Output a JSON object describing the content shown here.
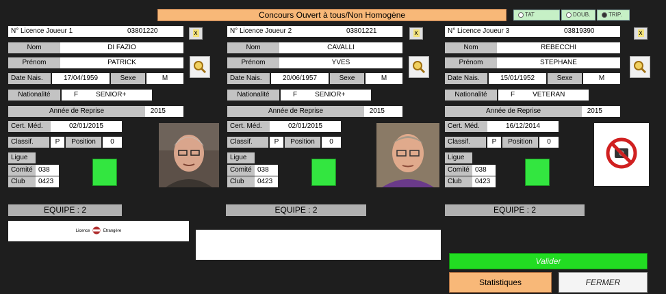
{
  "window": {
    "title": "Concours Ouvert à tous/Non Homogène"
  },
  "mode_options": [
    {
      "label": "TAT",
      "selected": false
    },
    {
      "label": "DOUB.",
      "selected": false
    },
    {
      "label": "TRIP.",
      "selected": true
    }
  ],
  "labels": {
    "nom": "Nom",
    "prenom": "Prénom",
    "date_nais": "Date Nais.",
    "sexe": "Sexe",
    "nationalite": "Nationalité",
    "annee_reprise": "Année de Reprise",
    "cert_med": "Cert. Méd.",
    "classif": "Classif.",
    "position": "Position",
    "ligue": "Ligue",
    "comite": "Comité",
    "club": "Club",
    "remove_btn": "x"
  },
  "players": [
    {
      "licence_label": "N° Licence Joueur 1",
      "licence": "03801220",
      "nom": "DI FAZIO",
      "prenom": "PATRICK",
      "date_nais": "17/04/1959",
      "sexe": "M",
      "nationalite": "F",
      "categorie": "SENIOR+",
      "annee_reprise": "2015",
      "cert_med": "02/01/2015",
      "classif": "P",
      "position": "0",
      "comite": "038",
      "club": "0423",
      "equipe": "EQUIPE : 2",
      "photo": "player-photo"
    },
    {
      "licence_label": "N° Licence Joueur 2",
      "licence": "03801221",
      "nom": "CAVALLI",
      "prenom": "YVES",
      "date_nais": "20/06/1957",
      "sexe": "M",
      "nationalite": "F",
      "categorie": "SENIOR+",
      "annee_reprise": "2015",
      "cert_med": "02/01/2015",
      "classif": "P",
      "position": "0",
      "comite": "038",
      "club": "0423",
      "equipe": "EQUIPE : 2",
      "photo": "player-photo"
    },
    {
      "licence_label": "N° Licence Joueur 3",
      "licence": "03819390",
      "nom": "REBECCHI",
      "prenom": "STEPHANE",
      "date_nais": "15/01/1952",
      "sexe": "M",
      "nationalite": "F",
      "categorie": "VETERAN",
      "annee_reprise": "2015",
      "cert_med": "16/12/2014",
      "classif": "P",
      "position": "0",
      "comite": "038",
      "club": "0423",
      "equipe": "EQUIPE : 2",
      "photo": "no-photo-icon"
    }
  ],
  "licence_etrangere": {
    "left": "Licence",
    "right": "Etrangère"
  },
  "buttons": {
    "valider": "Valider",
    "statistiques": "Statistiques",
    "fermer": "FERMER"
  },
  "colors": {
    "background": "#1e1e1e",
    "title_bg": "#f8b878",
    "valider_bg": "#22dd22",
    "statistiques_bg": "#f8b878",
    "status_green": "#33e640"
  }
}
